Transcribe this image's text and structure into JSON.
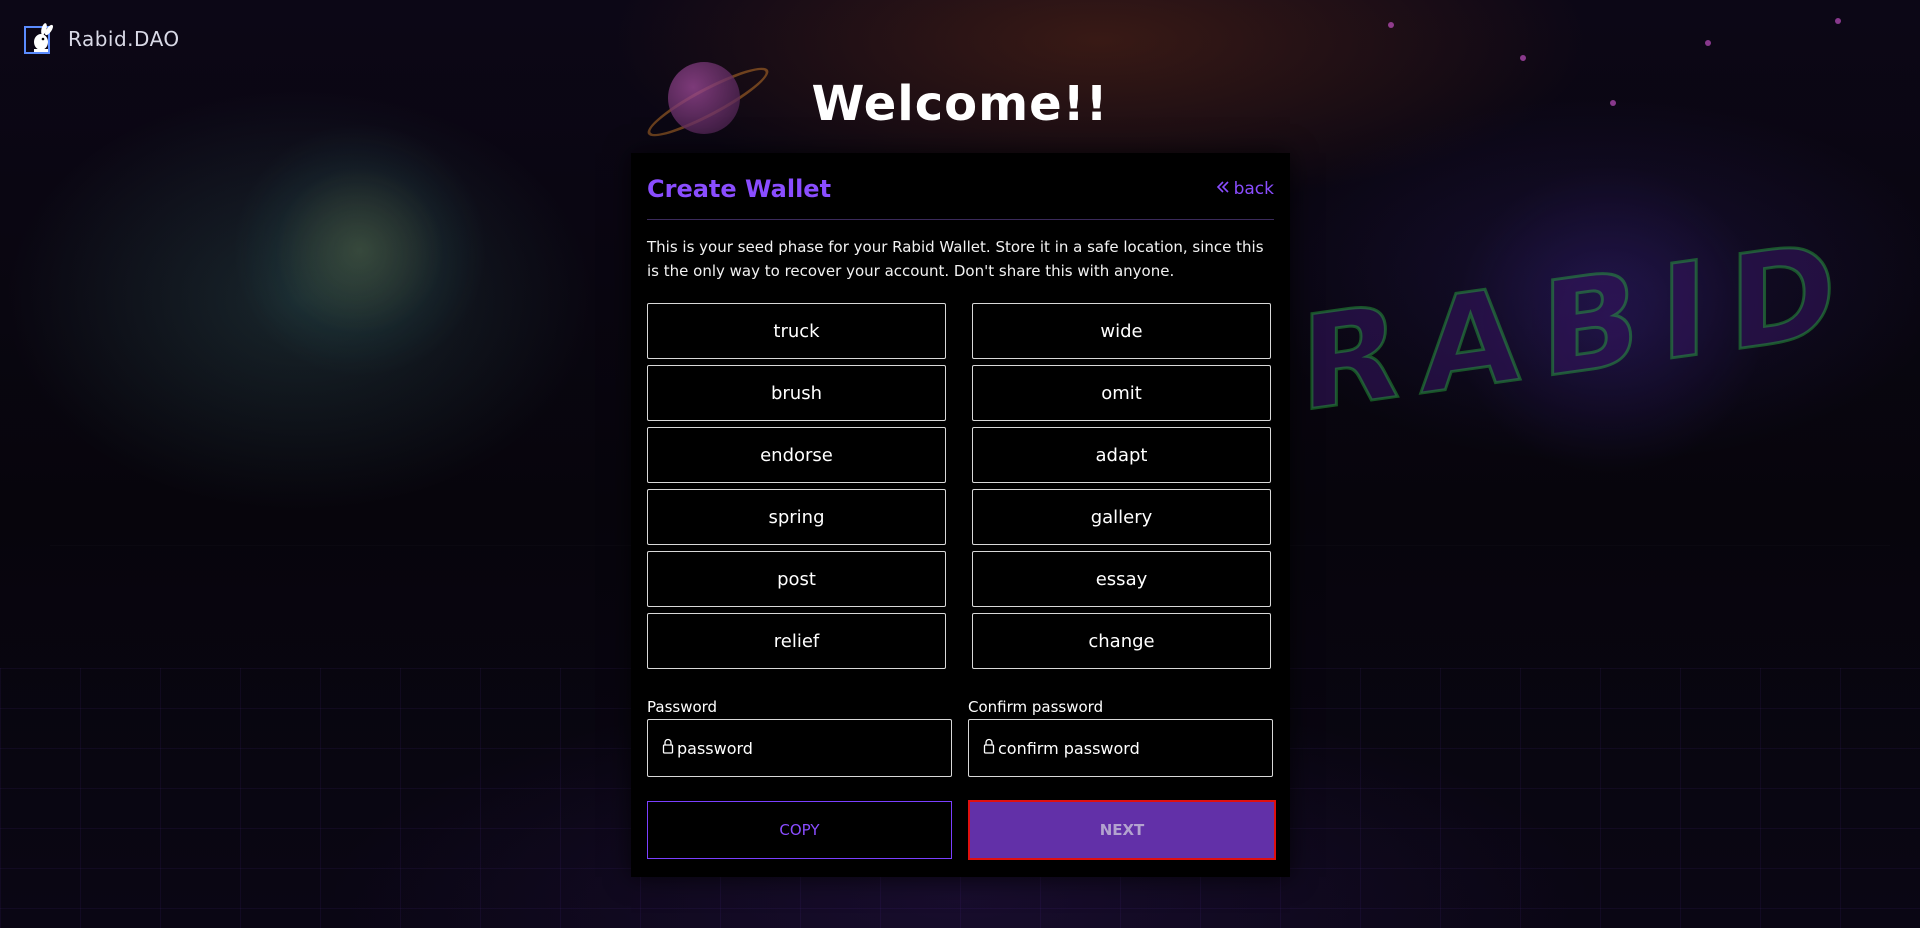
{
  "brand": {
    "name": "Rabid.DAO",
    "logo_icon": "rabbit-logo-icon"
  },
  "page": {
    "title": "Welcome!!"
  },
  "card": {
    "title": "Create Wallet",
    "back_label": "back",
    "back_icon": "double-chevron-left-icon",
    "description": "This is your seed phase for your Rabid Wallet. Store it in a safe location, since this is the only way to recover your account. Don't share this with anyone."
  },
  "seed_words": [
    "truck",
    "wide",
    "brush",
    "omit",
    "endorse",
    "adapt",
    "spring",
    "gallery",
    "post",
    "essay",
    "relief",
    "change"
  ],
  "password": {
    "label": "Password",
    "placeholder": "password",
    "icon": "lock-icon"
  },
  "confirm_password": {
    "label": "Confirm password",
    "placeholder": "confirm password",
    "icon": "lock-icon"
  },
  "actions": {
    "copy_label": "COPY",
    "next_label": "NEXT"
  },
  "colors": {
    "accent": "#8a4dff",
    "next_bg": "#6230a8",
    "next_border": "#e01010",
    "card_bg": "#000000"
  }
}
